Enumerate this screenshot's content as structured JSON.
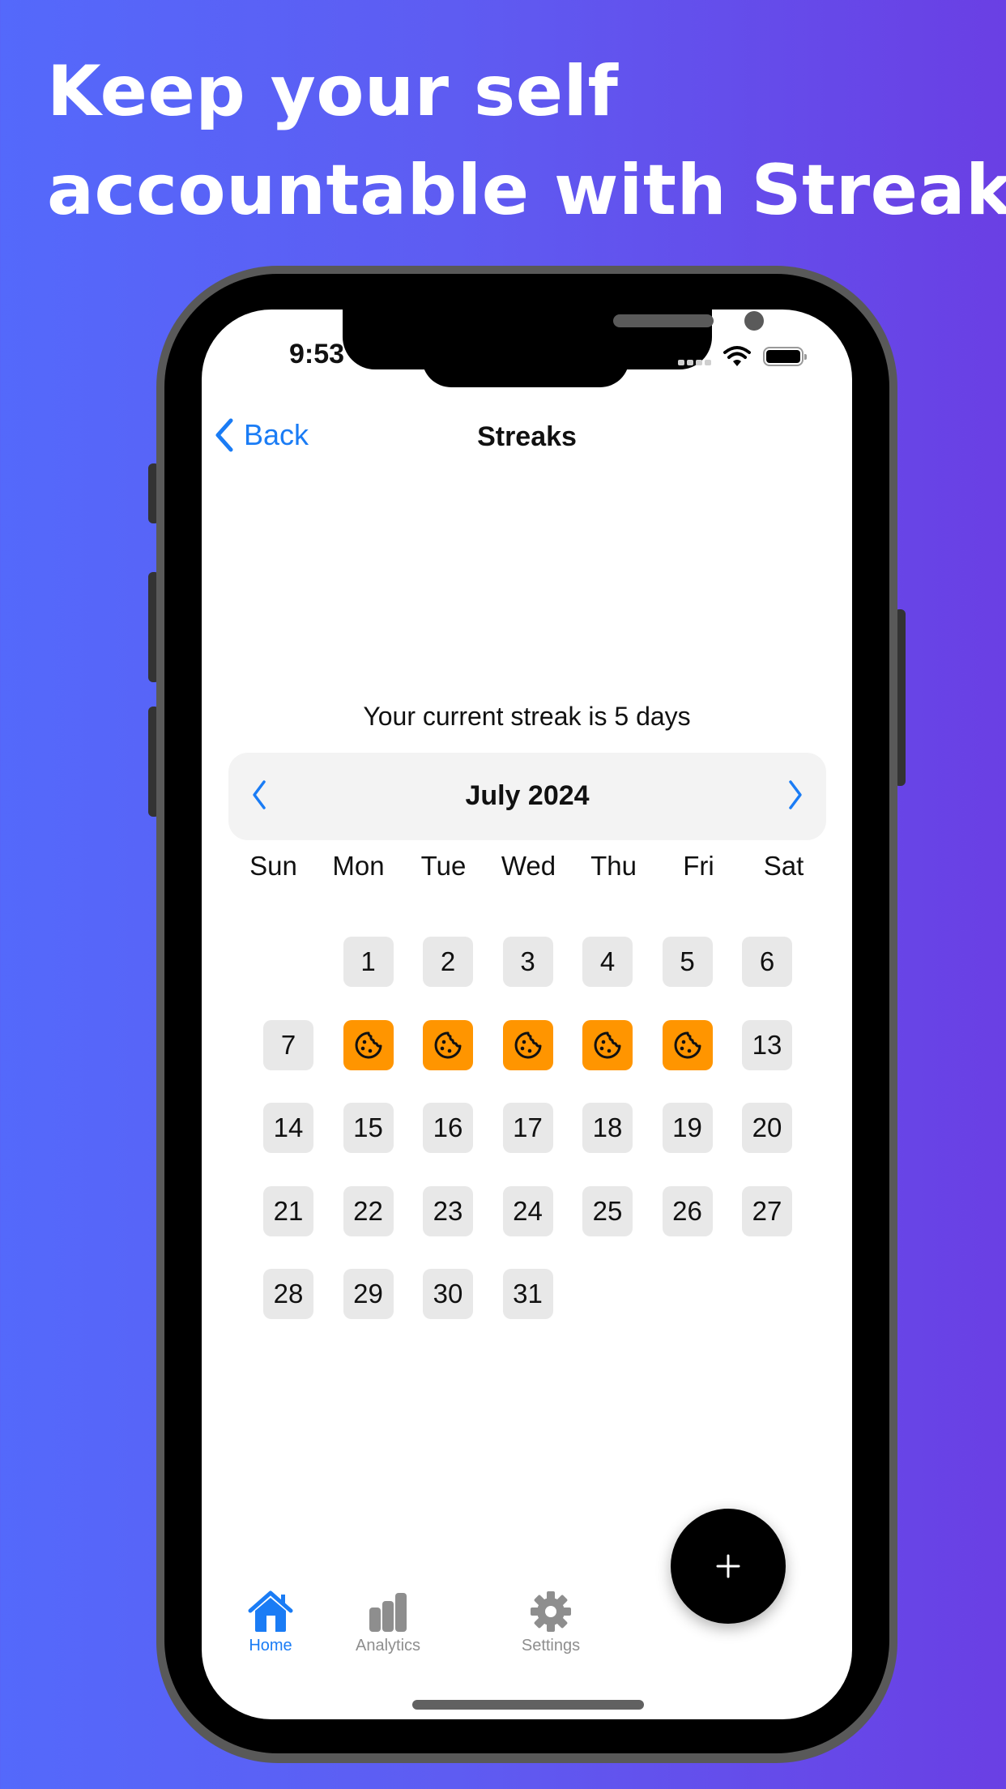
{
  "headline": {
    "line1": "Keep your self",
    "line2": "accountable with Streaks"
  },
  "status_bar": {
    "time": "9:53",
    "icons": [
      "signal-icon",
      "wifi-icon",
      "battery-icon"
    ]
  },
  "nav": {
    "back_label": "Back",
    "title": "Streaks"
  },
  "streak": {
    "message": "Your current streak is 5 days",
    "days": 5
  },
  "calendar": {
    "month_label": "July 2024",
    "prev_icon": "chevron-left-icon",
    "next_icon": "chevron-right-icon",
    "weekdays": [
      "Sun",
      "Mon",
      "Tue",
      "Wed",
      "Thu",
      "Fri",
      "Sat"
    ],
    "first_weekday_index": 1,
    "days_in_month": 31,
    "completed_days": [
      8,
      9,
      10,
      11,
      12
    ],
    "completed_icon": "cookie-icon",
    "active_color": "#ff9500",
    "inactive_color": "#e8e8e8"
  },
  "tabbar": {
    "tabs": [
      {
        "label": "Home",
        "icon": "home-icon",
        "active": true
      },
      {
        "label": "Analytics",
        "icon": "bar-chart-icon",
        "active": false
      },
      {
        "label": "Settings",
        "icon": "gear-icon",
        "active": false
      }
    ],
    "accent_color": "#1a7cf5"
  },
  "fab": {
    "icon": "plus-icon"
  }
}
